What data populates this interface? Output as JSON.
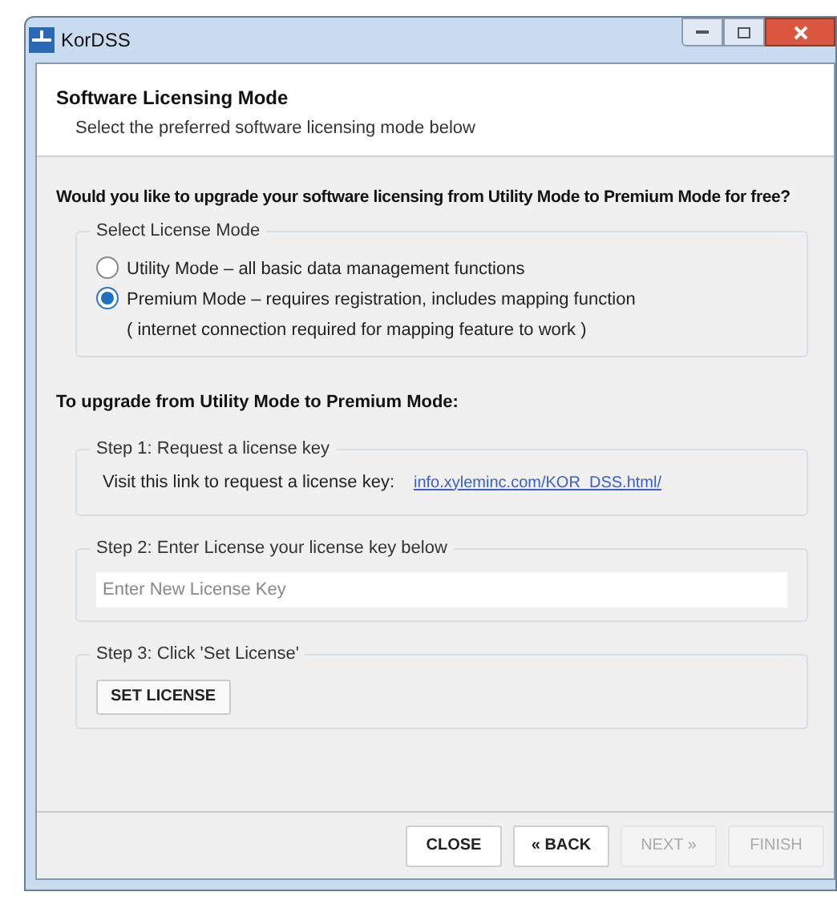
{
  "window": {
    "title": "KorDSS"
  },
  "header": {
    "title": "Software Licensing Mode",
    "subtitle": "Select the preferred software licensing mode below"
  },
  "question": "Would you like to upgrade your software licensing from Utility Mode to Premium Mode for free?",
  "license_mode": {
    "legend": "Select License Mode",
    "options": [
      {
        "label": "Utility Mode – all basic data management functions",
        "selected": false
      },
      {
        "label": "Premium Mode – requires registration, includes mapping function",
        "note": "( internet connection required for mapping feature to work )",
        "selected": true
      }
    ]
  },
  "upgrade_heading": "To upgrade from Utility Mode to Premium Mode:",
  "step1": {
    "legend": "Step 1: Request a license key",
    "text": "Visit this link to request a license key:",
    "link": "info.xyleminc.com/KOR_DSS.html/"
  },
  "step2": {
    "legend": "Step 2: Enter License your license key below",
    "placeholder": "Enter New License Key"
  },
  "step3": {
    "legend": "Step 3: Click 'Set License'",
    "button": "SET LICENSE"
  },
  "buttons": [
    {
      "label": "CLOSE",
      "disabled": false
    },
    {
      "label": "« BACK",
      "disabled": false
    },
    {
      "label": "NEXT »",
      "disabled": true
    },
    {
      "label": "FINISH",
      "disabled": true
    }
  ]
}
